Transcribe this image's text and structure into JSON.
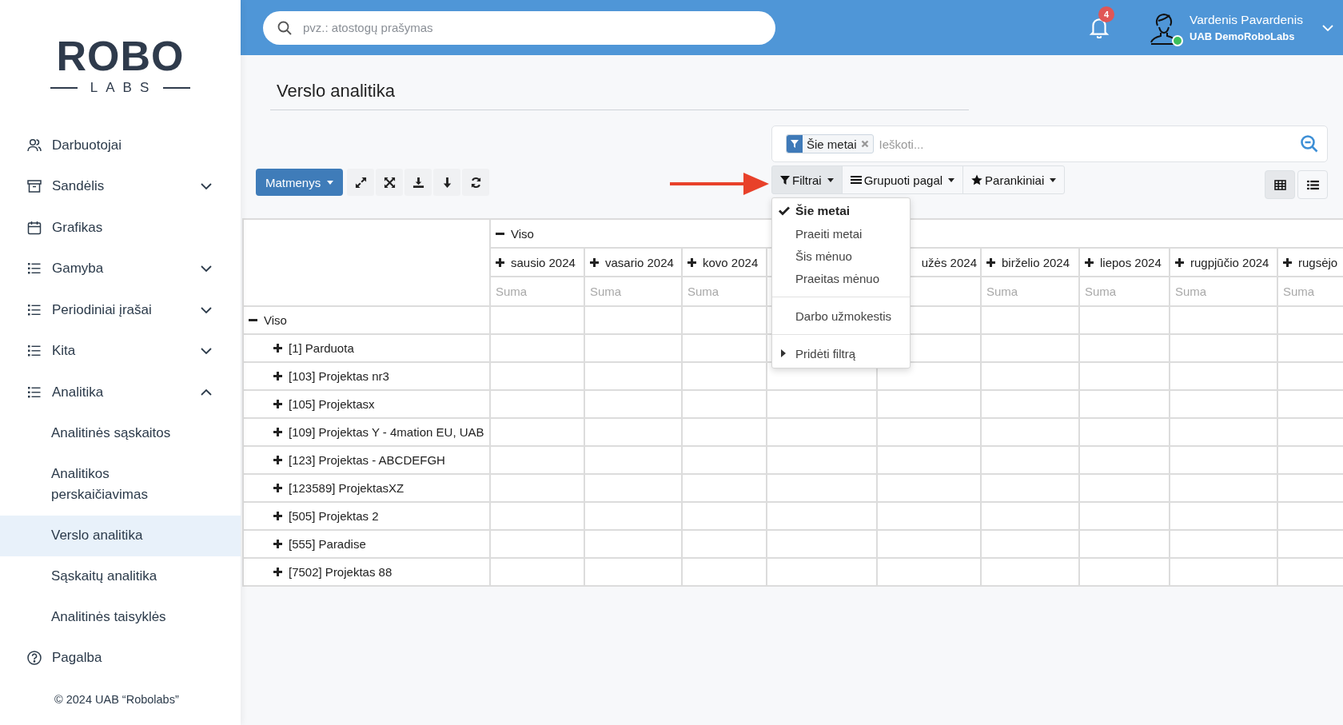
{
  "sidebar": {
    "logo": {
      "word": "ROBO",
      "subword": "LABS"
    },
    "items": [
      {
        "label": "Darbuotojai",
        "kind": "users"
      },
      {
        "label": "Sandėlis",
        "kind": "box",
        "expanded": false
      },
      {
        "label": "Grafikas",
        "kind": "calendar"
      },
      {
        "label": "Gamyba",
        "kind": "list",
        "expanded": false
      },
      {
        "label": "Periodiniai įrašai",
        "kind": "list",
        "expanded": false
      },
      {
        "label": "Kita",
        "kind": "list",
        "expanded": false
      },
      {
        "label": "Analitika",
        "kind": "list",
        "expanded": true,
        "children": [
          {
            "label": "Analitinės sąskaitos",
            "selected": false
          },
          {
            "label": "Analitikos perskaičiavimas",
            "selected": false
          },
          {
            "label": "Verslo analitika",
            "selected": true
          },
          {
            "label": "Sąskaitų analitika",
            "selected": false
          },
          {
            "label": "Analitinės taisyklės",
            "selected": false
          }
        ]
      },
      {
        "label": "Pagalba",
        "kind": "help"
      }
    ],
    "footer": "© 2024 UAB “Robolabs”"
  },
  "topbar": {
    "search": {
      "placeholder": "pvz.: atostogų prašymas"
    },
    "notifications": {
      "count": "4"
    },
    "user": {
      "name": "Vardenis Pavardenis",
      "company": "UAB DemoRoboLabs",
      "online": true
    }
  },
  "page": {
    "title": "Verslo analitika"
  },
  "search": {
    "facets": [
      {
        "label": "Šie metai"
      }
    ],
    "placeholder": "Ieškoti..."
  },
  "toolbar": {
    "dimensions_button": "Matmenys",
    "filters_button": {
      "label": "Filtrai",
      "open": true
    },
    "group_by_button": "Grupuoti pagal",
    "favorites_button": "Parankiniai",
    "view_modes": [
      {
        "kind": "pivot",
        "selected": true
      },
      {
        "kind": "list",
        "selected": false
      }
    ]
  },
  "filter_menu": {
    "groups": [
      {
        "items": [
          {
            "kind": "option",
            "label": "Šie metai",
            "selected": true
          },
          {
            "kind": "option",
            "label": "Praeiti metai",
            "selected": false
          },
          {
            "kind": "option",
            "label": "Šis mėnuo",
            "selected": false
          },
          {
            "kind": "option",
            "label": "Praeitas mėnuo",
            "selected": false
          }
        ]
      },
      {
        "items": [
          {
            "kind": "option",
            "label": "Darbo užmokestis",
            "selected": false
          }
        ]
      },
      {
        "items": [
          {
            "kind": "submenu",
            "label": "Pridėti filtrą"
          }
        ]
      }
    ]
  },
  "table": {
    "column_group": {
      "label": "Viso",
      "expanded": true
    },
    "columns": [
      {
        "kind": "month",
        "label": "sausio 2024",
        "expanded": false,
        "measure": "Suma"
      },
      {
        "kind": "month",
        "label": "vasario 2024",
        "expanded": false,
        "measure": "Suma"
      },
      {
        "kind": "month",
        "label": "kovo 2024",
        "expanded": false,
        "measure": "Suma"
      },
      {
        "kind": "covered"
      },
      {
        "kind": "cut",
        "label": "užės 2024"
      },
      {
        "kind": "month",
        "label": "birželio 2024",
        "expanded": false,
        "measure": "Suma"
      },
      {
        "kind": "month",
        "label": "liepos 2024",
        "expanded": false,
        "measure": "Suma"
      },
      {
        "kind": "month",
        "label": "rugpjūčio 2024",
        "expanded": false,
        "measure": "Suma"
      },
      {
        "kind": "month",
        "label": "rugsėjo",
        "expanded": false,
        "measure": "Suma"
      }
    ],
    "rows": [
      {
        "label": "Viso",
        "expanded": true,
        "children": [
          {
            "label": "[1] Parduota",
            "expanded": false
          },
          {
            "label": "[103] Projektas nr3",
            "expanded": false
          },
          {
            "label": "[105] Projektasx",
            "expanded": false
          },
          {
            "label": "[109] Projektas Y - 4mation EU, UAB",
            "expanded": false
          },
          {
            "label": "[123] Projektas - ABCDEFGH",
            "expanded": false
          },
          {
            "label": "[123589] ProjektasXZ",
            "expanded": false
          },
          {
            "label": "[505] Projektas 2",
            "expanded": false
          },
          {
            "label": "[555] Paradise",
            "expanded": false
          },
          {
            "label": "[7502] Projektas 88",
            "expanded": false
          }
        ]
      }
    ]
  }
}
